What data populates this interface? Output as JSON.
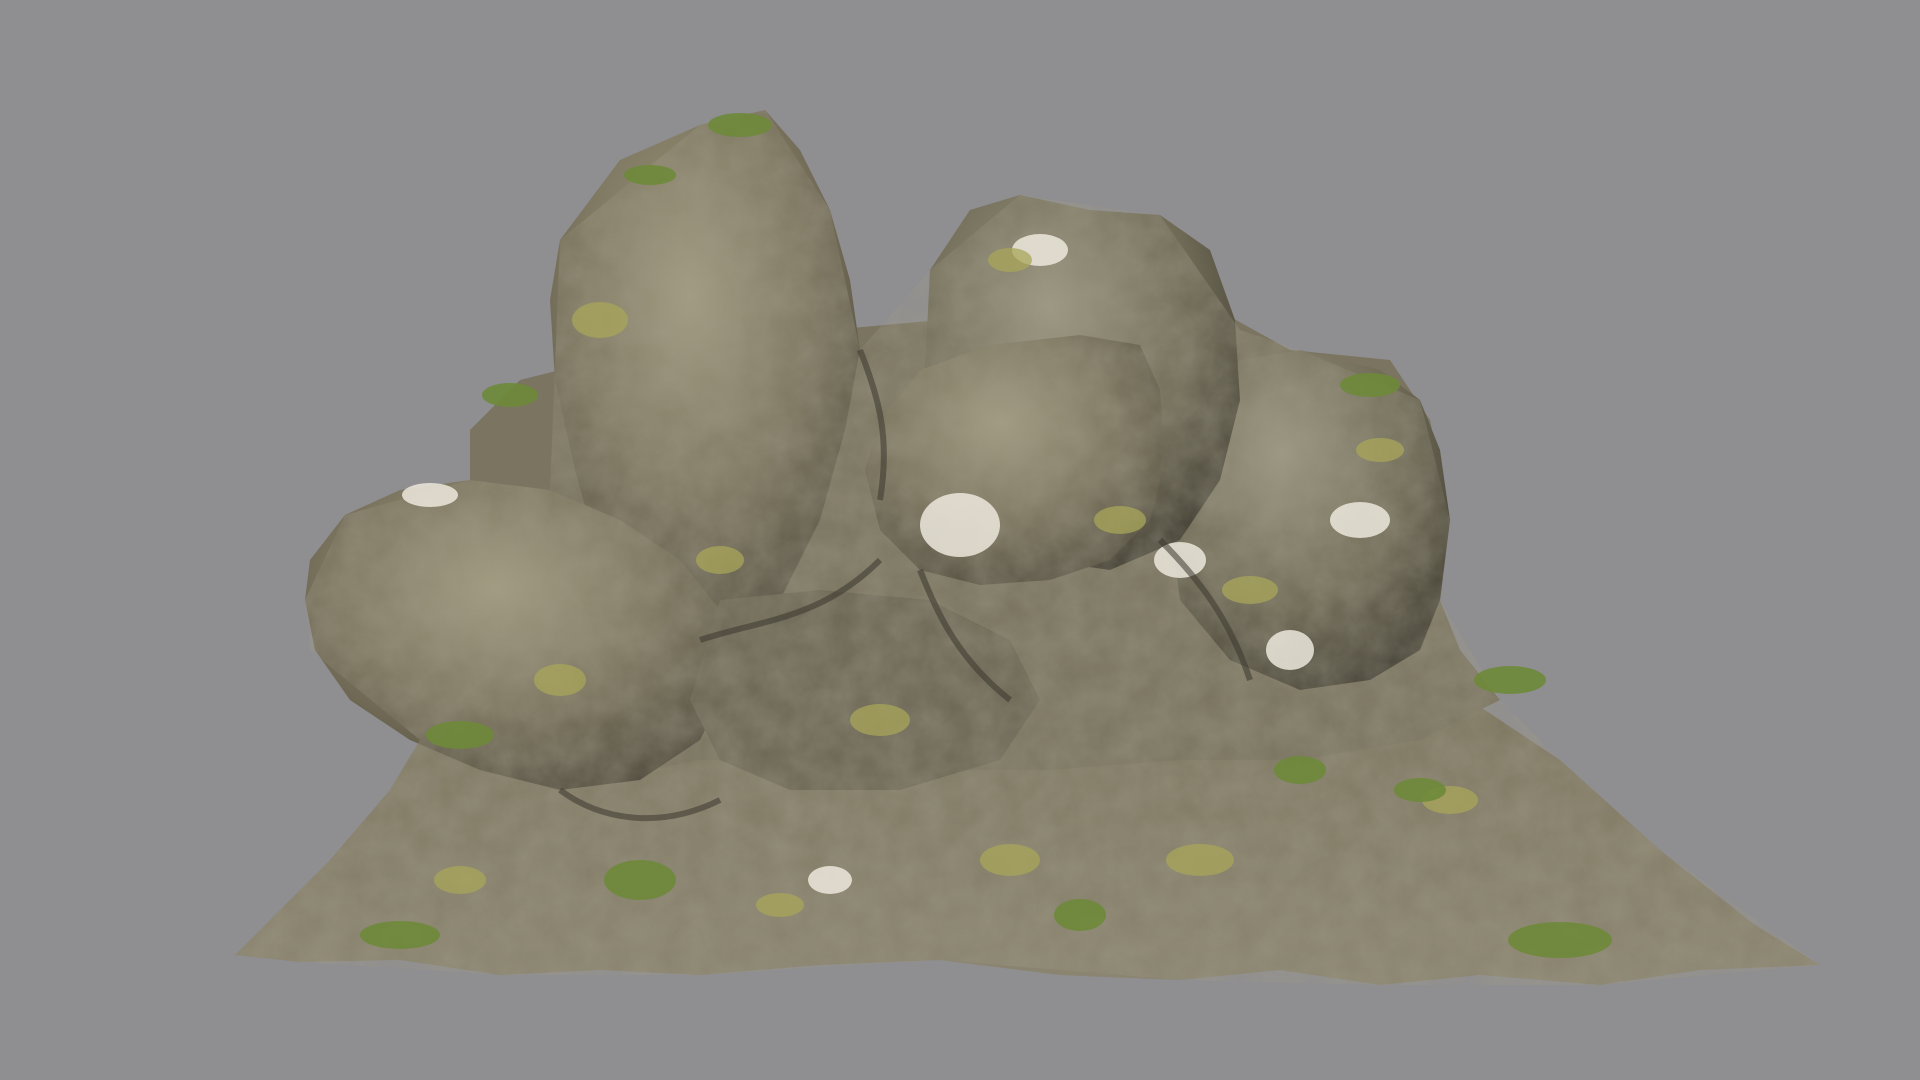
{
  "scene": {
    "background_color": "#8f8e90",
    "subject": "rock-formation-3d-model",
    "palette": {
      "rock_light": "#a39c82",
      "rock_mid": "#7d7660",
      "rock_dark": "#4f4a3c",
      "rock_shadow": "#3a372d",
      "lichen": "#a8a65a",
      "lichen_pale": "#c7c690",
      "highlight": "#ece8dc",
      "grass": "#6e8a3a",
      "grass_dark": "#4f6a2a"
    }
  }
}
